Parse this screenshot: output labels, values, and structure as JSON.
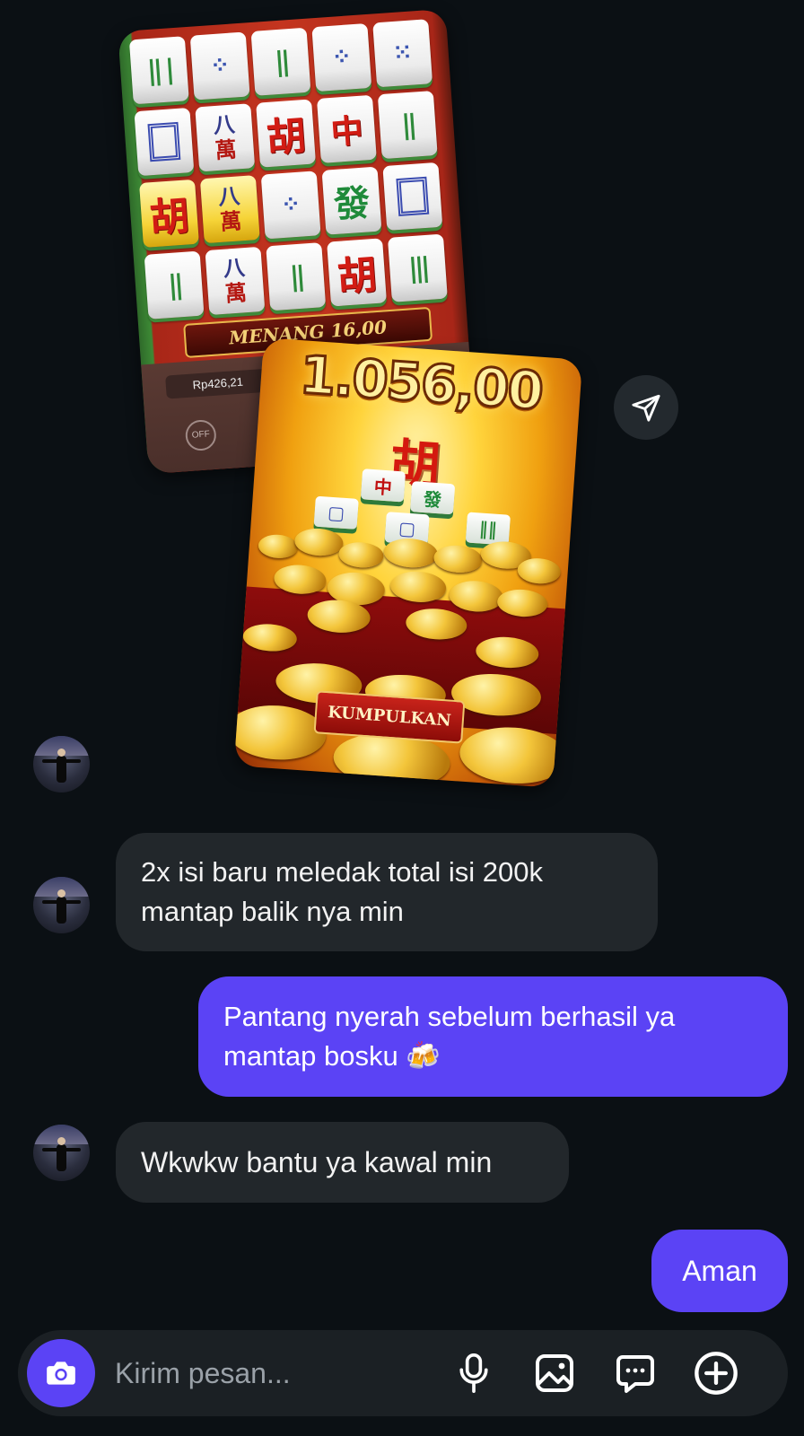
{
  "images": {
    "mahjong_board": {
      "win_label": "MENANG 16,00",
      "balance": "Rp426,21",
      "tiles": [
        [
          "‖‖",
          "⁘",
          "‖‖",
          "⁘",
          "⁘"
        ],
        [
          "▢",
          "八萬",
          "胡",
          "中",
          "‖‖"
        ],
        [
          "胡",
          "八萬",
          "⁘",
          "發",
          "▢"
        ],
        [
          "‖‖",
          "八萬",
          "‖‖",
          "胡",
          "‖‖"
        ]
      ]
    },
    "big_win": {
      "amount": "1.056,00",
      "character": "胡",
      "collect_button": "KUMPULKAN",
      "tile_chars": [
        "中",
        "發",
        "胡"
      ]
    }
  },
  "actions": {
    "share_icon": "paper-plane-icon"
  },
  "messages": [
    {
      "direction": "incoming",
      "text": "2x isi baru meledak total isi 200k mantap balik nya min"
    },
    {
      "direction": "outgoing",
      "text": "Pantang nyerah sebelum berhasil ya mantap bosku 🍻"
    },
    {
      "direction": "incoming",
      "text": "Wkwkw bantu ya kawal min"
    },
    {
      "direction": "outgoing",
      "text": "Aman"
    }
  ],
  "composer": {
    "placeholder": "Kirim pesan...",
    "icons": [
      "camera-icon",
      "microphone-icon",
      "image-icon",
      "sticker-message-icon",
      "plus-icon"
    ]
  },
  "colors": {
    "background": "#0b1014",
    "incoming_bubble": "#22272b",
    "outgoing_bubble": "#5b43f5",
    "composer_bg": "#1b2024"
  }
}
